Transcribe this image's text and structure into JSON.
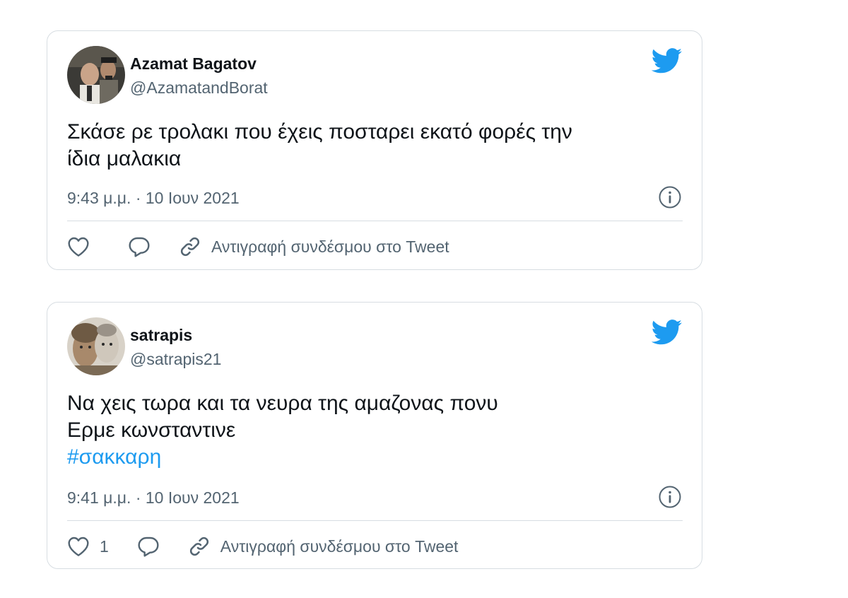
{
  "tweets": [
    {
      "display_name": "Azamat Bagatov",
      "handle": "@AzamatandBorat",
      "text_lines": [
        "Σκάσε ρε τρολακι που έχεις ποσταρει εκατό φορές την",
        "ίδια μαλακια"
      ],
      "timestamp": "9:43 μ.μ. · 10 Ιουν 2021",
      "like_count": "",
      "copy_link_label": "Αντιγραφή συνδέσμου στο Tweet",
      "icons": [
        "avatar",
        "twitter-bird-icon",
        "info-icon",
        "heart-icon",
        "reply-icon",
        "link-icon"
      ]
    },
    {
      "display_name": "satrapis",
      "handle": "@satrapis21",
      "text_lines": [
        "Να χεις τωρα και τα νευρα της αμαζονας πονυ",
        "Ερμε κωνσταντινε"
      ],
      "hashtag": "#σακκαρη",
      "timestamp": "9:41 μ.μ. · 10 Ιουν 2021",
      "like_count": "1",
      "copy_link_label": "Αντιγραφή συνδέσμου στο Tweet",
      "icons": [
        "avatar",
        "twitter-bird-icon",
        "info-icon",
        "heart-icon",
        "reply-icon",
        "link-icon"
      ]
    }
  ],
  "colors": {
    "text_primary": "#0f1419",
    "text_secondary": "#536471",
    "accent": "#1d9bf0",
    "border": "#d7dde2"
  }
}
